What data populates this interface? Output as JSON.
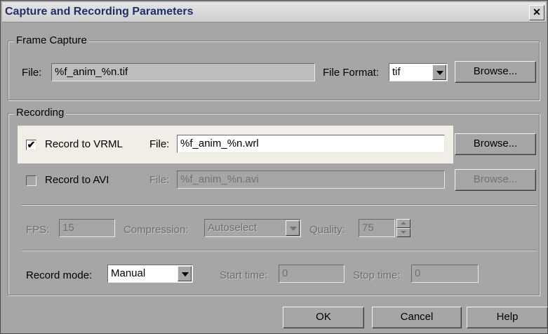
{
  "window": {
    "title": "Capture and Recording Parameters",
    "close_glyph": "✕"
  },
  "frame_capture": {
    "legend": "Frame Capture",
    "file_label": "File:",
    "file_value": "%f_anim_%n.tif",
    "format_label": "File Format:",
    "format_value": "tif",
    "browse_label": "Browse..."
  },
  "recording": {
    "legend": "Recording",
    "vrml": {
      "label": "Record to VRML",
      "checked": true,
      "check_glyph": "✔",
      "file_label": "File:",
      "file_value": "%f_anim_%n.wrl",
      "browse_label": "Browse..."
    },
    "avi": {
      "label": "Record to AVI",
      "checked": false,
      "file_label": "File:",
      "file_value": "%f_anim_%n.avi",
      "browse_label": "Browse..."
    },
    "fps_label": "FPS:",
    "fps_value": "15",
    "compression_label": "Compression:",
    "compression_value": "Autoselect",
    "quality_label": "Quality:",
    "quality_value": "75",
    "mode_label": "Record mode:",
    "mode_value": "Manual",
    "start_label": "Start time:",
    "start_value": "0",
    "stop_label": "Stop time:",
    "stop_value": "0"
  },
  "buttons": {
    "ok": "OK",
    "cancel": "Cancel",
    "help": "Help"
  }
}
